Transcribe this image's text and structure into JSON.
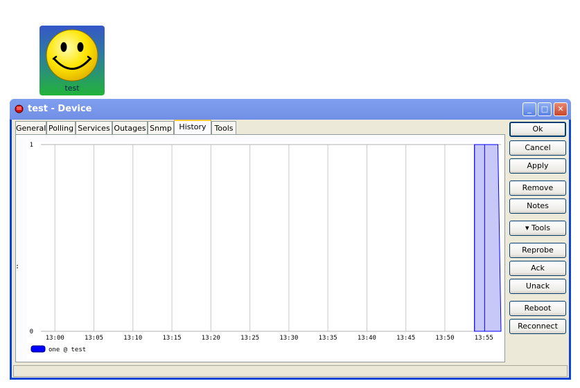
{
  "desktop_icon": {
    "label": "test",
    "icon": "smiley-face-icon"
  },
  "window": {
    "title": "test - Device",
    "controls": {
      "minimize": "_",
      "maximize": "□",
      "close": "✕"
    }
  },
  "tabs": [
    {
      "label": "General"
    },
    {
      "label": "Polling"
    },
    {
      "label": "Services"
    },
    {
      "label": "Outages"
    },
    {
      "label": "Snmp"
    },
    {
      "label": "History",
      "active": true
    },
    {
      "label": "Tools"
    }
  ],
  "side_axis_label": ":",
  "buttons": {
    "ok": "Ok",
    "cancel": "Cancel",
    "apply": "Apply",
    "remove": "Remove",
    "notes": "Notes",
    "tools": "▾ Tools",
    "reprobe": "Reprobe",
    "ack": "Ack",
    "unack": "Unack",
    "reboot": "Reboot",
    "reconnect": "Reconnect"
  },
  "chart_data": {
    "type": "area",
    "x_ticks": [
      "13:00",
      "13:05",
      "13:10",
      "13:15",
      "13:20",
      "13:25",
      "13:30",
      "13:35",
      "13:40",
      "13:45",
      "13:50",
      "13:55"
    ],
    "y_ticks": [
      "0",
      "1"
    ],
    "ylim": [
      0,
      1
    ],
    "xlim_minutes": [
      -1.8,
      57.2
    ],
    "grid": true,
    "legend_position": "bottom-left",
    "series": [
      {
        "name": "one @ test",
        "color": "#0000ff",
        "fill": "#c8c8f8",
        "points": [
          [
            53.8,
            0
          ],
          [
            53.8,
            1
          ],
          [
            56.8,
            1
          ],
          [
            57.2,
            0
          ]
        ],
        "markers_minutes": [
          53.8,
          55.1
        ]
      }
    ]
  }
}
